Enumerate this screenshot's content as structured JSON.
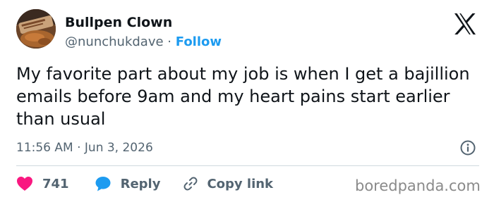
{
  "author": {
    "display_name": "Bullpen Clown",
    "handle": "@nunchukdave",
    "separator": "·",
    "follow_label": "Follow",
    "follow_color": "#1d9bf0",
    "avatar_icon": "profile-photo-avatar"
  },
  "tweet": {
    "text": "My favorite part about my job is when I get a bajillion emails before 9am and my heart pains start earlier than usual",
    "timestamp": "11:56 AM · Jun 3, 2026"
  },
  "actions": {
    "like_count": "741",
    "like_color": "#f91880",
    "reply_label": "Reply",
    "reply_color": "#1d9bf0",
    "copy_label": "Copy link"
  },
  "icons": {
    "platform": "x-logo-icon",
    "info": "info-icon",
    "like": "heart-icon",
    "reply": "speech-bubble-icon",
    "copy": "link-icon"
  },
  "watermark": {
    "text": "boredpanda.com"
  }
}
